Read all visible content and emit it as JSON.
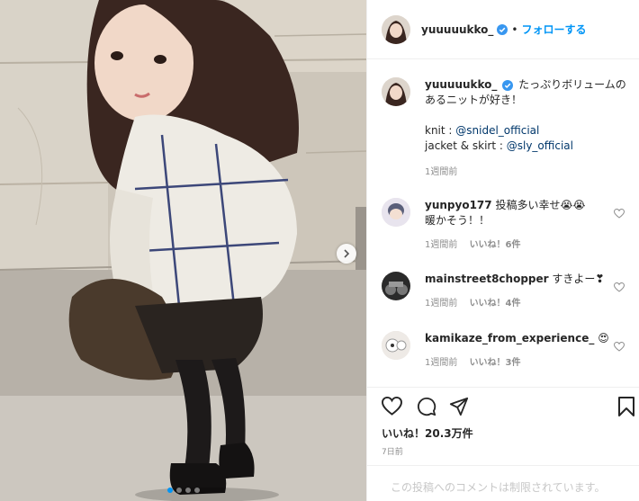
{
  "post": {
    "photo_alt": "",
    "carousel": {
      "total": 4,
      "active": 0
    }
  },
  "header": {
    "username": "yuuuuukko_",
    "separator": "•",
    "follow_label": "フォローする"
  },
  "caption": {
    "username": "yuuuuukko_",
    "text_line1": "たっぷりボリュームの",
    "text_line2": "あるニットが好き！",
    "credit1_prefix": "knit : ",
    "credit1_handle": "@snidel_official",
    "credit2_prefix": "jacket & skirt : ",
    "credit2_handle": "@sly_official",
    "time": "1週間前"
  },
  "comments": [
    {
      "username": "yunpyo177",
      "text_line1": "投稿多い幸せ😭😭",
      "text_line2": "暖かそう！！",
      "time": "1週間前",
      "likes": "いいね！6件"
    },
    {
      "username": "mainstreet8chopper",
      "text_line1": "すきよー❣",
      "text_line2": "",
      "time": "1週間前",
      "likes": "いいね！4件"
    },
    {
      "username": "kamikaze_from_experience_",
      "text_line1": "😍",
      "text_line2": "",
      "time": "1週間前",
      "likes": "いいね！3件"
    }
  ],
  "actions": {
    "likes_total": "いいね！20.3万件",
    "posted": "7日前"
  },
  "footer": {
    "restricted_text": "この投稿へのコメントは制限されています。"
  },
  "colors": {
    "accent": "#0095f6",
    "link": "#00376b",
    "muted": "#8e8e8e"
  }
}
